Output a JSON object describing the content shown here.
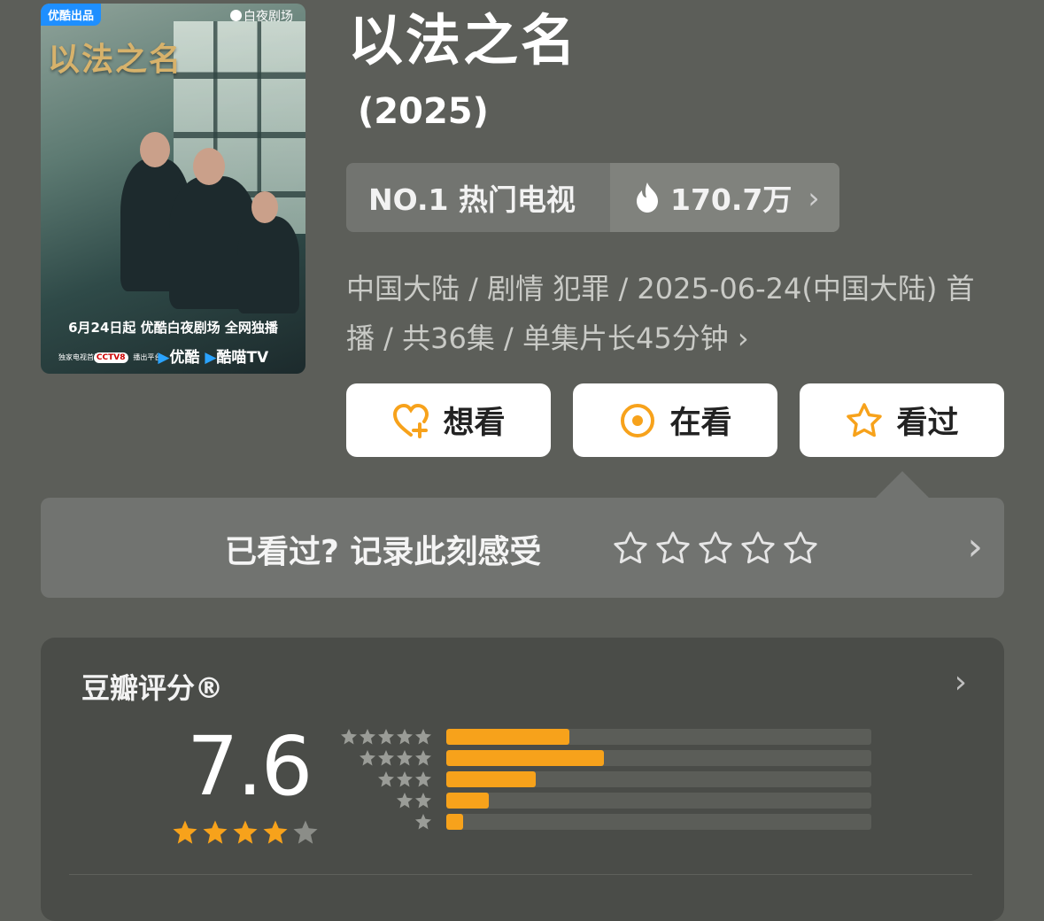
{
  "poster": {
    "badge": "优酷出品",
    "network": "白夜剧场",
    "title_art": "以法之名",
    "airing": "6月24日起 优酷白夜剧场 全网独播",
    "platforms": {
      "small_label_1": "独家电视首播平台",
      "cctv": "CCTV8",
      "small_label_2": "播出平台",
      "youku": "优酷",
      "kumiao": "酷喵TV"
    }
  },
  "movie": {
    "title": "以法之名",
    "year": "(2025)"
  },
  "rank": {
    "label": "NO.1 热门电视",
    "heat": "170.7万",
    "chevron": "›"
  },
  "meta": {
    "line": "中国大陆 / 剧情 犯罪 / 2025-06-24(中国大陆) 首播 / 共36集 / 单集片长45分钟",
    "chevron": "›"
  },
  "actions": {
    "want": "想看",
    "watching": "在看",
    "watched": "看过"
  },
  "record": {
    "prompt": "已看过? 记录此刻感受",
    "chevron": "›"
  },
  "rating": {
    "header": "豆瓣评分®",
    "chevron": "›",
    "score": "7.6",
    "stars_filled": 4,
    "distribution": [
      {
        "stars": 5,
        "fraction": 0.29
      },
      {
        "stars": 4,
        "fraction": 0.37
      },
      {
        "stars": 3,
        "fraction": 0.21
      },
      {
        "stars": 2,
        "fraction": 0.1
      },
      {
        "stars": 1,
        "fraction": 0.04
      }
    ]
  },
  "colors": {
    "accent": "#f7a21b",
    "background": "#5c5e59"
  }
}
